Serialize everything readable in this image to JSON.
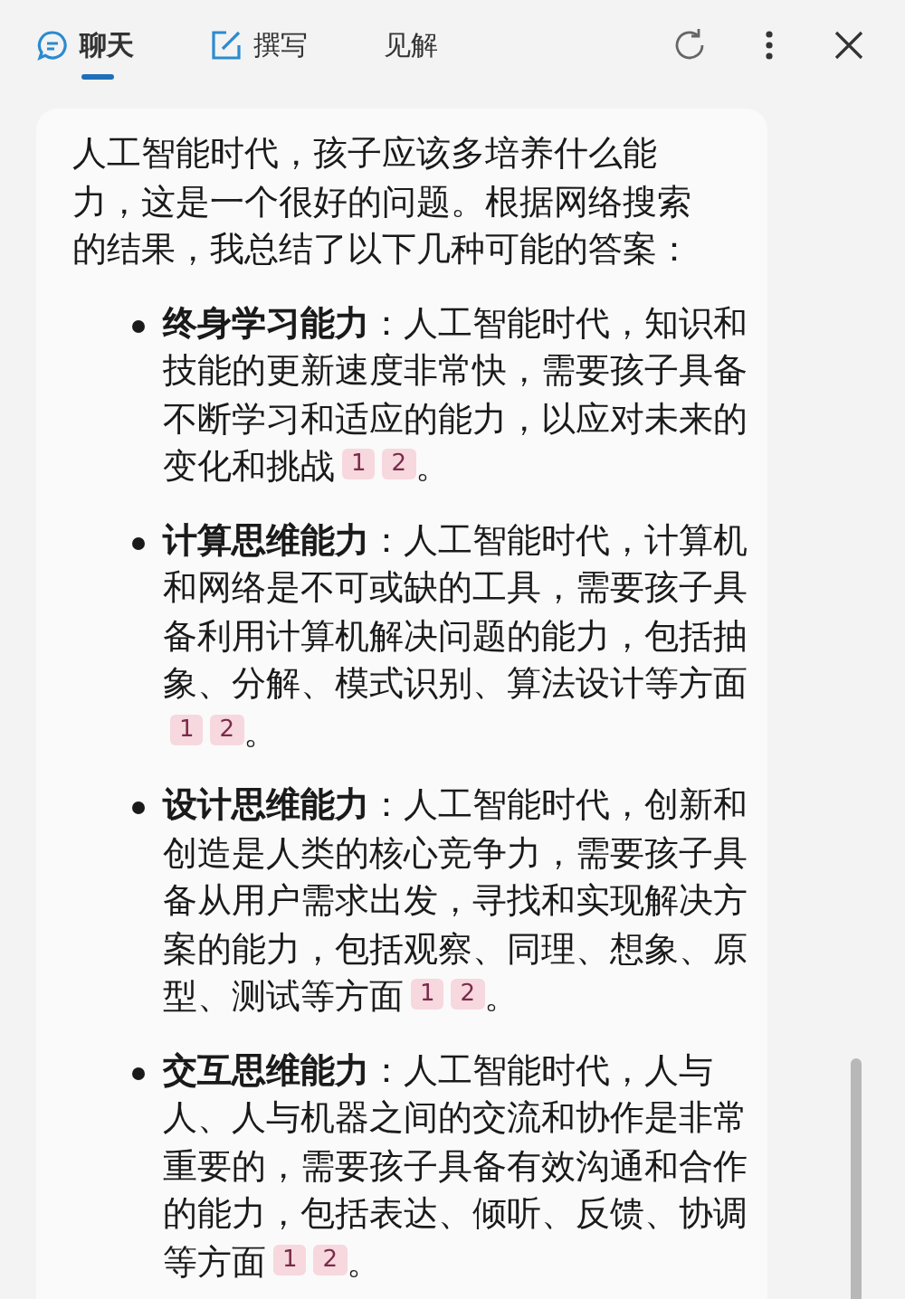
{
  "tabs": [
    {
      "label": "聊天",
      "selected": true
    },
    {
      "label": "撰写",
      "selected": false
    },
    {
      "label": "见解",
      "selected": false
    }
  ],
  "message": {
    "intro": "人工智能时代，孩子应该多培养什么能力，这是一个很好的问题。根据网络搜索的结果，我总结了以下几种可能的答案：",
    "items": [
      {
        "term": "终身学习能力",
        "text": "：人工智能时代，知识和技能的更新速度非常快，需要孩子具备不断学习和适应的能力，以应对未来的变化和挑战",
        "citations": [
          "1",
          "2"
        ],
        "end": "。"
      },
      {
        "term": "计算思维能力",
        "text": "：人工智能时代，计算机和网络是不可或缺的工具，需要孩子具备利用计算机解决问题的能力，包括抽象、分解、模式识别、算法设计等方面",
        "citations": [
          "1",
          "2"
        ],
        "end": "。"
      },
      {
        "term": "设计思维能力",
        "text": "：人工智能时代，创新和创造是人类的核心竞争力，需要孩子具备从用户需求出发，寻找和实现解决方案的能力，包括观察、同理、想象、原型、测试等方面",
        "citations": [
          "1",
          "2"
        ],
        "end": "。"
      },
      {
        "term": "交互思维能力",
        "text": "：人工智能时代，人与人、人与机器之间的交流和协作是非常重要的，需要孩子具备有效沟通和合作的能力，包括表达、倾听、反馈、协调等方面",
        "citations": [
          "1",
          "2"
        ],
        "end": "。"
      }
    ]
  }
}
